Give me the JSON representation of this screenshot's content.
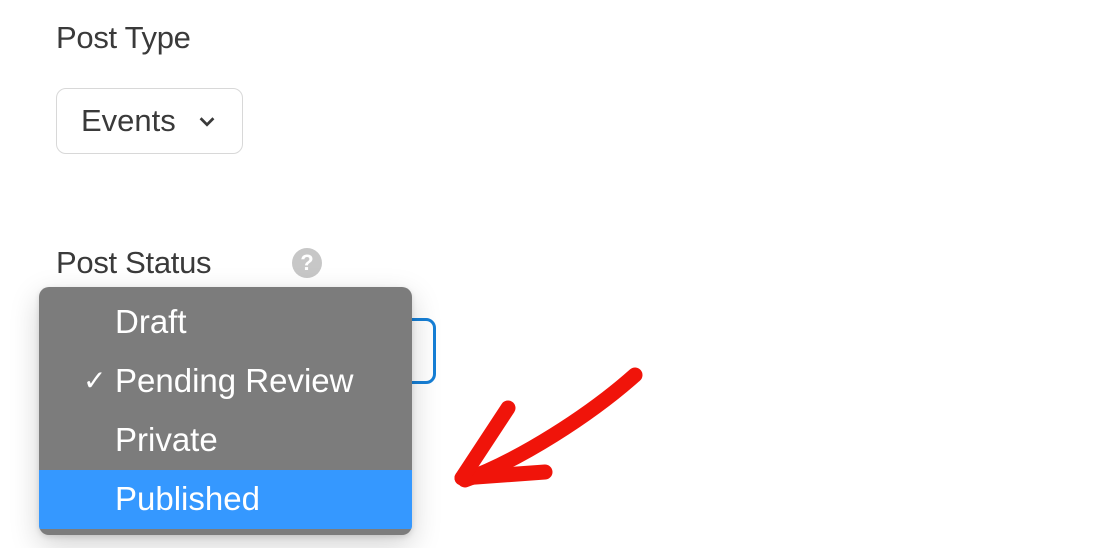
{
  "postType": {
    "label": "Post Type",
    "selected": "Events"
  },
  "postStatus": {
    "label": "Post Status",
    "options": [
      {
        "label": "Draft",
        "checked": false,
        "highlight": false
      },
      {
        "label": "Pending Review",
        "checked": true,
        "highlight": false
      },
      {
        "label": "Private",
        "checked": false,
        "highlight": false
      },
      {
        "label": "Published",
        "checked": false,
        "highlight": true
      }
    ]
  },
  "help": {
    "glyph": "?"
  }
}
